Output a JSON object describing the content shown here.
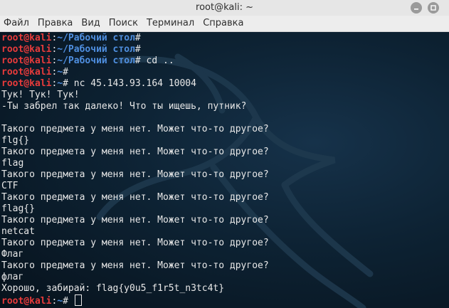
{
  "window": {
    "title": "root@kali: ~",
    "minimize_icon": "minimize-icon",
    "maximize_icon": "maximize-icon"
  },
  "menu": [
    "Файл",
    "Правка",
    "Вид",
    "Поиск",
    "Терминал",
    "Справка"
  ],
  "prompt": {
    "user": "root@kali",
    "sep": ":",
    "path_desktop": "~/Рабочий стол",
    "path_home": "~",
    "symbol": "# "
  },
  "terminal": {
    "cmd1": "",
    "cmd2": "",
    "cmd3": "cd ..",
    "cmd4": "",
    "cmd5": "nc 45.143.93.164 10004",
    "out": [
      "Тук! Тук! Тук!",
      "-Ты забрел так далеко! Что ты ищешь, путник?",
      "",
      "Такого предмета у меня нет. Может что-то другое?",
      "flg{}",
      "Такого предмета у меня нет. Может что-то другое?",
      "flag",
      "Такого предмета у меня нет. Может что-то другое?",
      "CTF",
      "Такого предмета у меня нет. Может что-то другое?",
      "flag{}",
      "Такого предмета у меня нет. Может что-то другое?",
      "netcat",
      "Такого предмета у меня нет. Может что-то другое?",
      "Флаг",
      "Такого предмета у меня нет. Может что-то другое?",
      "флаг",
      "Хорошо, забирай: flag{y0u5_f1r5t_n3tc4t}"
    ]
  },
  "colors": {
    "prompt_user": "#e83b3b",
    "prompt_path": "#4f8fe0",
    "text": "#e8e8e8",
    "background": "#0b1a26"
  }
}
